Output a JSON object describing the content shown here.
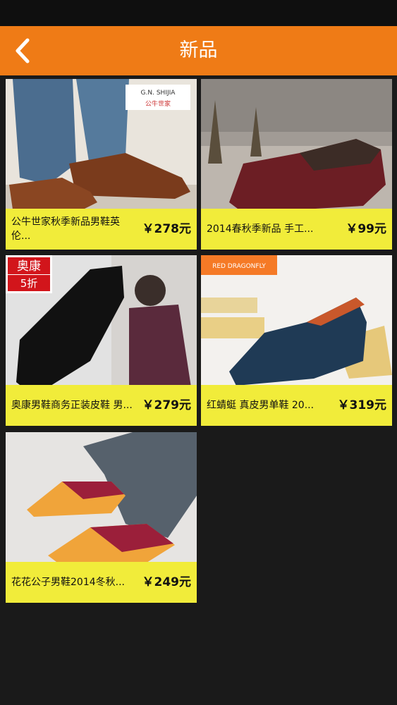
{
  "header": {
    "title": "新品",
    "back_icon": "chevron-left-icon",
    "background": "#ef7b16"
  },
  "colors": {
    "caption_bg": "#f1ec3a",
    "page_bg": "#1a1a1a"
  },
  "products": [
    {
      "name": "公牛世家秋季新品男鞋英伦...",
      "price": "￥278元",
      "badge": "G.N. SHIJIA 公牛世家"
    },
    {
      "name": "2014春秋季新品 手工...",
      "price": "￥99元"
    },
    {
      "name": "奥康男鞋商务正装皮鞋 男...",
      "price": "￥279元",
      "badge": "奥康 5折"
    },
    {
      "name": "红蜻蜓 真皮男单鞋 20...",
      "price": "￥319元",
      "badge": "RED DRAGONFLY 红蜻蜓"
    },
    {
      "name": "花花公子男鞋2014冬秋...",
      "price": "￥249元"
    }
  ]
}
